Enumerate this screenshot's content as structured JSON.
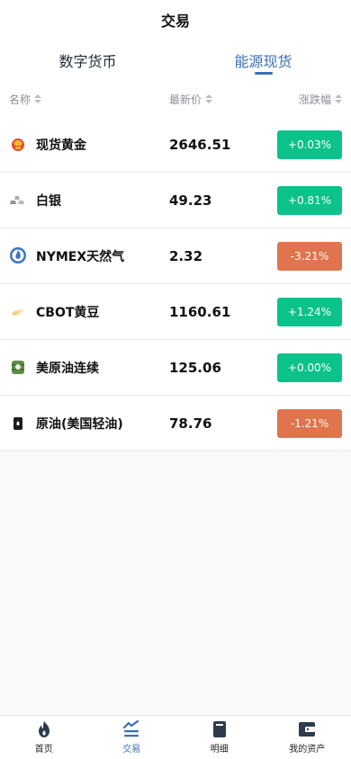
{
  "header": {
    "title": "交易"
  },
  "tabs": [
    {
      "label": "数字货币",
      "active": false
    },
    {
      "label": "能源现货",
      "active": true
    }
  ],
  "columns": {
    "name": "名称",
    "price": "最新价",
    "change": "涨跌幅"
  },
  "items": [
    {
      "name": "现货黄金",
      "price": "2646.51",
      "change": "+0.03%",
      "direction": "up",
      "icon": "gold-icon"
    },
    {
      "name": "白银",
      "price": "49.23",
      "change": "+0.81%",
      "direction": "up",
      "icon": "silver-icon"
    },
    {
      "name": "NYMEX天然气",
      "price": "2.32",
      "change": "-3.21%",
      "direction": "down",
      "icon": "natural-gas-icon"
    },
    {
      "name": "CBOT黄豆",
      "price": "1160.61",
      "change": "+1.24%",
      "direction": "up",
      "icon": "soybean-icon"
    },
    {
      "name": "美原油连续",
      "price": "125.06",
      "change": "+0.00%",
      "direction": "up",
      "icon": "oil-barrel-icon"
    },
    {
      "name": "原油(美国轻油)",
      "price": "78.76",
      "change": "-1.21%",
      "direction": "down",
      "icon": "crude-oil-icon"
    }
  ],
  "colors": {
    "up": "#0bc28a",
    "down": "#e0754d",
    "accent": "#3b6fb6"
  },
  "nav": [
    {
      "label": "首页",
      "icon": "flame-icon",
      "active": false
    },
    {
      "label": "交易",
      "icon": "trade-icon",
      "active": true
    },
    {
      "label": "明细",
      "icon": "book-icon",
      "active": false
    },
    {
      "label": "我的资产",
      "icon": "wallet-icon",
      "active": false
    }
  ]
}
